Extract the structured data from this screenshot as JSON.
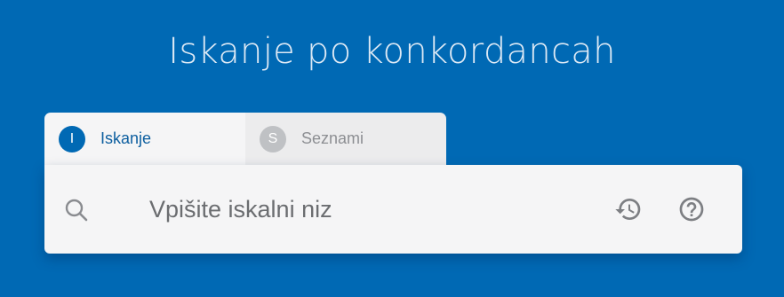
{
  "header": {
    "title": "Iskanje po konkordancah"
  },
  "tabs": [
    {
      "badge": "I",
      "label": "Iskanje",
      "active": true
    },
    {
      "badge": "S",
      "label": "Seznami",
      "active": false
    }
  ],
  "search": {
    "placeholder": "Vpišite iskalni niz",
    "value": "",
    "icons": {
      "search": "search-icon",
      "history": "history-icon",
      "help": "help-icon"
    }
  },
  "colors": {
    "background": "#0069b4",
    "panel": "#f5f5f6",
    "accent": "#0069b4",
    "inactive_badge": "#bfc1c4"
  }
}
